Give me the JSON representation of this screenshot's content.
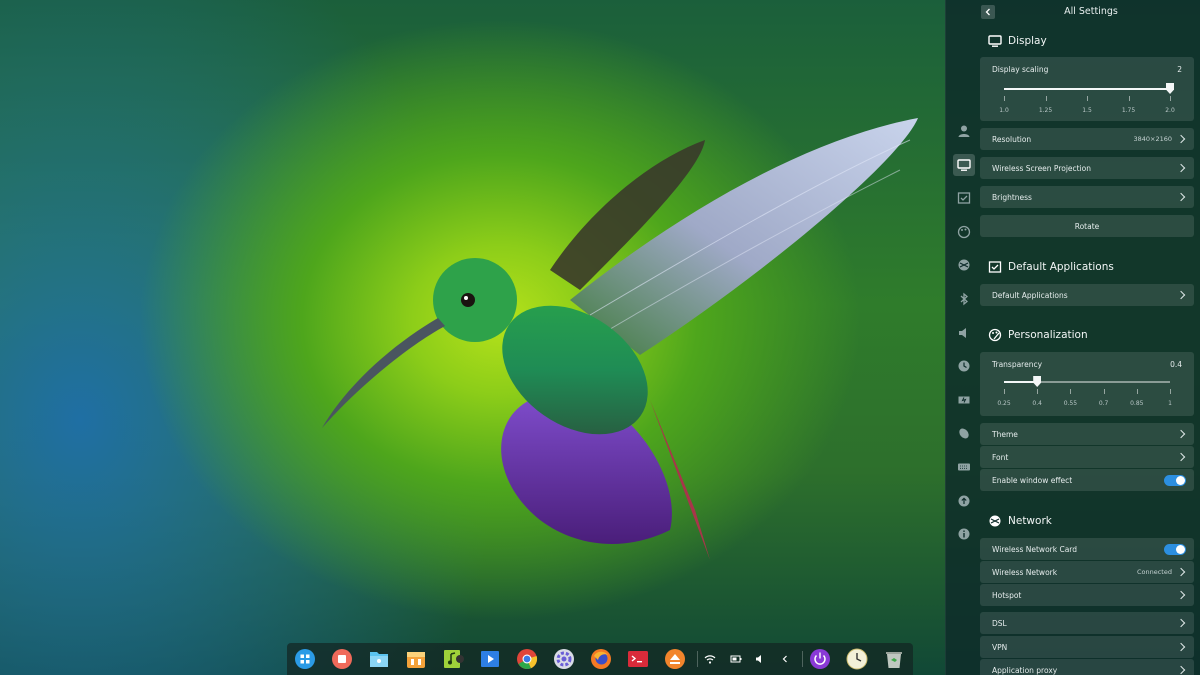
{
  "panel": {
    "title": "All Settings",
    "sections": {
      "display": "Display",
      "default_apps": "Default Applications",
      "personalization": "Personalization",
      "network": "Network"
    },
    "display_scaling": {
      "label": "Display scaling",
      "value": "2",
      "current": 2.0,
      "min": 1.0,
      "max": 2.0,
      "ticks": [
        "1.0",
        "1.25",
        "1.5",
        "1.75",
        "2.0"
      ]
    },
    "resolution": {
      "label": "Resolution",
      "value": "3840×2160"
    },
    "wireless_projection": {
      "label": "Wireless Screen Projection"
    },
    "brightness": {
      "label": "Brightness"
    },
    "rotate": {
      "label": "Rotate"
    },
    "default_applications": {
      "label": "Default Applications"
    },
    "transparency": {
      "label": "Transparency",
      "value": "0.4",
      "current": 0.4,
      "min": 0.25,
      "max": 1.0,
      "ticks": [
        "0.25",
        "0.4",
        "0.55",
        "0.7",
        "0.85",
        "1"
      ]
    },
    "theme": {
      "label": "Theme"
    },
    "font": {
      "label": "Font"
    },
    "window_effect": {
      "label": "Enable window effect",
      "enabled": true
    },
    "wireless_card": {
      "label": "Wireless Network Card",
      "enabled": true
    },
    "wireless_network": {
      "label": "Wireless Network",
      "value": "Connected"
    },
    "hotspot": {
      "label": "Hotspot"
    },
    "dsl": {
      "label": "DSL"
    },
    "vpn": {
      "label": "VPN"
    },
    "app_proxy": {
      "label": "Application proxy"
    }
  },
  "nav_icons": [
    "user-icon",
    "display-icon",
    "default-apps-icon",
    "personalization-icon",
    "network-icon",
    "bluetooth-icon",
    "sound-icon",
    "time-icon",
    "power-icon",
    "mouse-icon",
    "keyboard-icon",
    "update-icon",
    "info-icon"
  ],
  "dock": {
    "apps": [
      "launcher-icon",
      "multitasking-icon",
      "file-manager-icon",
      "app-store-icon",
      "music-icon",
      "movie-icon",
      "chrome-icon",
      "control-center-icon",
      "firefox-icon",
      "terminal-icon",
      "installer-icon"
    ],
    "tray": [
      "wifi-icon",
      "battery-icon",
      "volume-icon",
      "expand-tray-icon"
    ],
    "right": [
      "shutdown-icon",
      "clock-icon",
      "trash-icon"
    ]
  },
  "colors": {
    "accent": "#2c8fe0",
    "panel_bg": "#0e2c2a"
  }
}
